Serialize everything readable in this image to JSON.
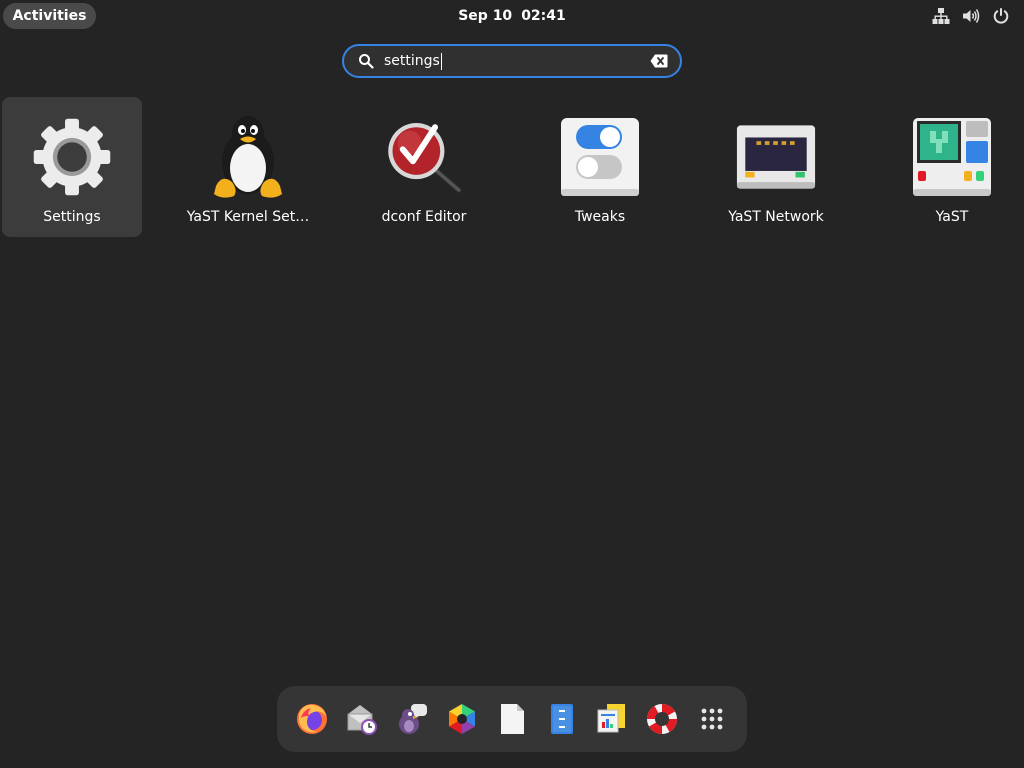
{
  "topbar": {
    "activities_label": "Activities",
    "date": "Sep 10",
    "time": "02:41",
    "status_icons": [
      "network-icon",
      "volume-icon",
      "power-icon"
    ]
  },
  "search": {
    "query": "settings"
  },
  "results": [
    {
      "label": "Settings",
      "icon": "settings-gear-icon",
      "selected": true
    },
    {
      "label": "YaST Kernel Set…",
      "icon": "tux-penguin-icon",
      "selected": false
    },
    {
      "label": "dconf Editor",
      "icon": "dconf-magnifier-icon",
      "selected": false
    },
    {
      "label": "Tweaks",
      "icon": "tweaks-toggles-icon",
      "selected": false
    },
    {
      "label": "YaST Network",
      "icon": "network-card-icon",
      "selected": false
    },
    {
      "label": "YaST",
      "icon": "yast-computer-icon",
      "selected": false
    }
  ],
  "dash": {
    "items": [
      "firefox-icon",
      "mail-clock-icon",
      "pidgin-chat-icon",
      "color-wheel-icon",
      "document-icon",
      "file-cabinet-icon",
      "presentation-icon",
      "help-lifebuoy-icon",
      "app-grid-icon"
    ]
  },
  "colors": {
    "background": "#242424",
    "accent": "#3584e4",
    "selected_tile": "#3c3c3c",
    "dash": "#353535"
  }
}
